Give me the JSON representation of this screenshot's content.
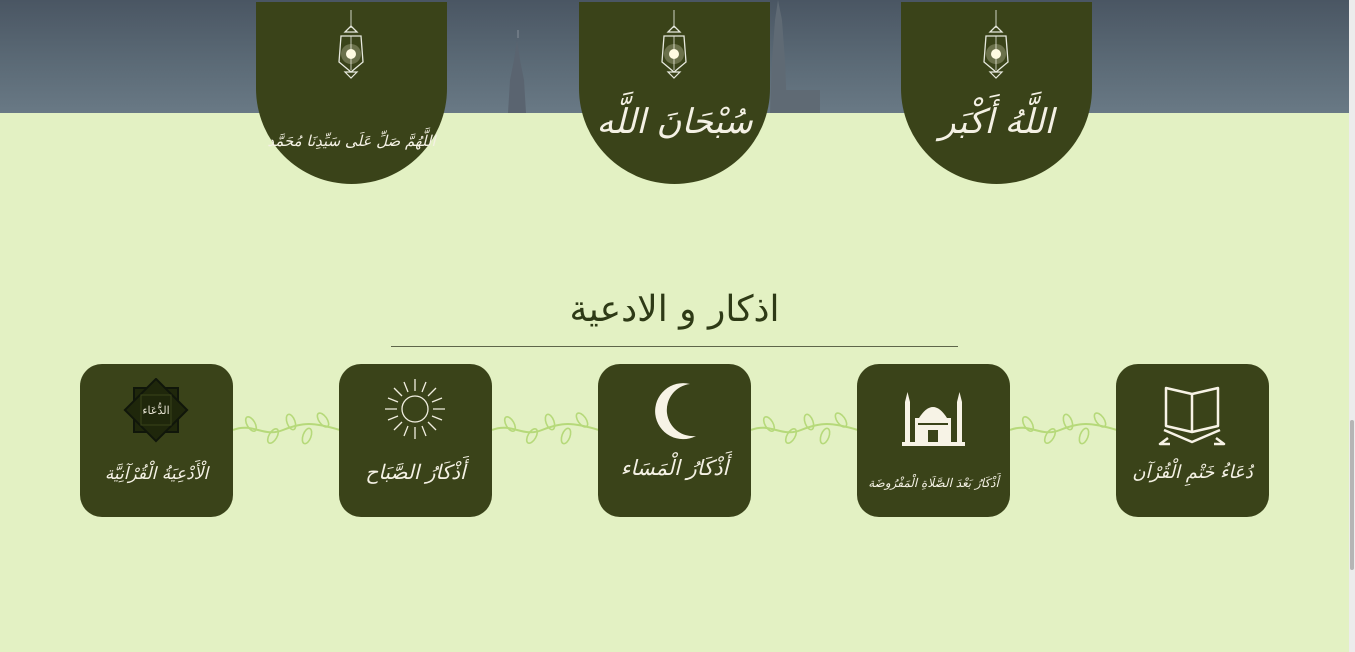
{
  "header": {
    "domes": [
      {
        "text": "اللَّهُمَّ صَلِّ عَلَى سَيِّدِنَا مُحَمَّد",
        "icon": "lantern-icon"
      },
      {
        "text": "سُبْحَانَ اللَّه",
        "icon": "lantern-icon"
      },
      {
        "text": "اللَّهُ أَكْبَر",
        "icon": "lantern-icon"
      }
    ]
  },
  "section": {
    "title": "اذكار و الادعية"
  },
  "cards": [
    {
      "label": "الْأَدْعِيَةُ الْقُرْآنِيَّة",
      "icon": "octagram-icon",
      "icon_text": "الدُّعَاء"
    },
    {
      "label": "أَذْكَارُ الصَّبَاح",
      "icon": "sun-icon"
    },
    {
      "label": "أَذْكَارُ الْمَسَاء",
      "icon": "crescent-moon-icon"
    },
    {
      "label": "أَذْكَارُ بَعْدَ الصَّلَاةِ الْمَفْرُوضَة",
      "icon": "mosque-icon"
    },
    {
      "label": "دُعَاءُ خَتْمِ الْقُرْآن",
      "icon": "quran-icon"
    }
  ],
  "colors": {
    "background": "#e3f1c3",
    "card": "#3a4319",
    "text_light": "#f4f1e4",
    "vine": "#b6d97a",
    "sky": "#5b6a76"
  }
}
